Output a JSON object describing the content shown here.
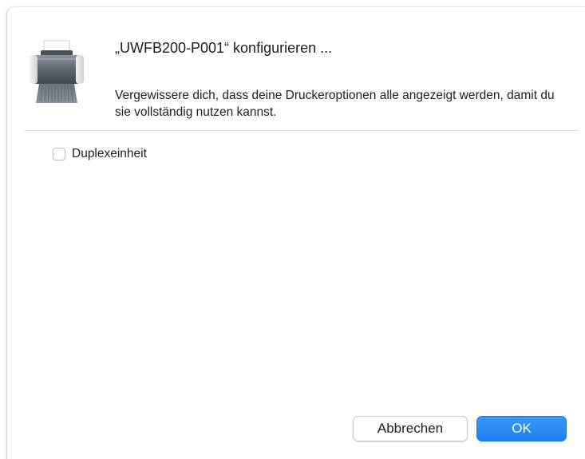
{
  "dialog": {
    "title": "„UWFB200-P001“ konfigurieren ...",
    "message": "Vergewissere dich, dass deine Druckeroptionen alle angezeigt werden, damit du sie vollständig nutzen kannst.",
    "icon": "printer-icon"
  },
  "options": [
    {
      "label": "Duplexeinheit",
      "checked": false
    }
  ],
  "buttons": {
    "cancel_label": "Abbrechen",
    "ok_label": "OK"
  },
  "colors": {
    "accent": "#1b7ff2",
    "text": "#1d1d1f",
    "divider": "#dcdcdc"
  }
}
